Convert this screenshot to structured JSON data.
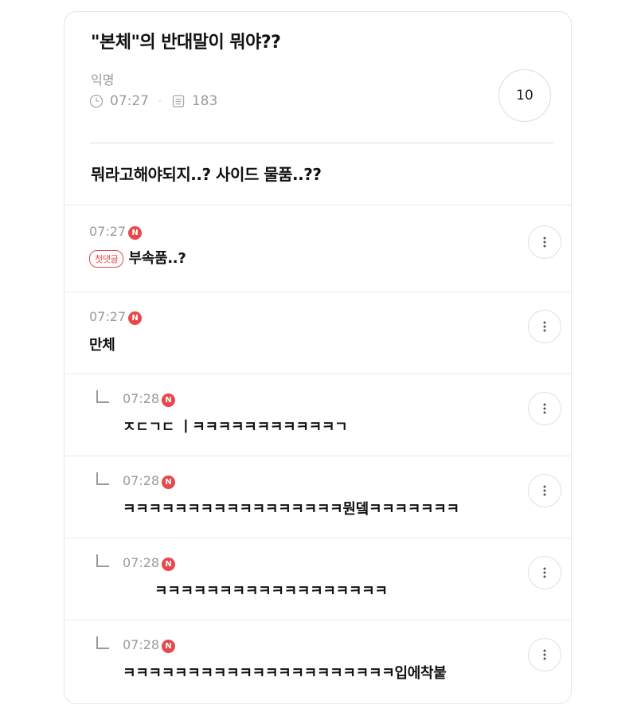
{
  "post": {
    "title": "\"본체\"의 반대말이 뭐야??",
    "author": "익명",
    "time": "07:27",
    "views": "183",
    "comment_count": "10",
    "body": "뭐라고해야되지..? 사이드 물품..??"
  },
  "icons": {
    "clock": "clock-icon",
    "views": "document-icon",
    "more": "more-vertical-icon",
    "reply": "reply-arrow-icon"
  },
  "colors": {
    "accent": "#e8484c",
    "muted": "#9a9a9a"
  },
  "comments": [
    {
      "time": "07:27",
      "badge": "N",
      "first_label": "첫댓글",
      "text": "부속품..?",
      "reply": false
    },
    {
      "time": "07:27",
      "badge": "N",
      "text": "만체",
      "reply": false
    },
    {
      "time": "07:28",
      "badge": "N",
      "text": "ㅈㄷㄱㄷ    ㅣㅋㅋㅋㅋㅋㅋㅋㅋㅋㅋㅋㄱ",
      "reply": true
    },
    {
      "time": "07:28",
      "badge": "N",
      "text": "ㅋㅋㅋㅋㅋㅋㅋㅋㅋㅋㅋㅋㅋㅋㅋㅋㅋ뭔뎈ㅋㅋㅋㅋㅋㅋㅋ",
      "reply": true
    },
    {
      "time": "07:28",
      "badge": "N",
      "text": "ㅋㅋㅋㅋㅋㅋㅋㅋㅋㅋㅋㅋㅋㅋㅋㅋㅋㅋ",
      "reply": true
    },
    {
      "time": "07:28",
      "badge": "N",
      "text": "ㅋㅋㅋㅋㅋㅋㅋㅋㅋㅋㅋㅋㅋㅋㅋㅋㅋㅋㅋㅋㅋ입에착붙",
      "reply": true
    }
  ]
}
